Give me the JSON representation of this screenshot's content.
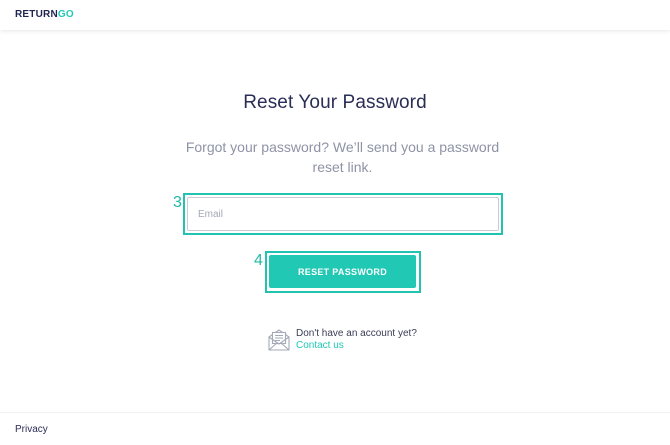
{
  "header": {
    "logo_part1": "RETURN",
    "logo_part2": "GO"
  },
  "main": {
    "title": "Reset Your Password",
    "subtitle": "Forgot your password? We’ll send you a password reset link.",
    "email": {
      "placeholder": "Email",
      "value": ""
    },
    "reset_button_label": "RESET PASSWORD",
    "annotations": {
      "email_marker": "3",
      "button_marker": "4"
    },
    "signup": {
      "prompt": "Don't have an account yet?",
      "link_label": "Contact us",
      "icon": "envelope-icon"
    }
  },
  "footer": {
    "privacy_label": "Privacy"
  },
  "colors": {
    "accent": "#21c9b5",
    "title": "#2a2d55",
    "subtitle": "#8e93a6"
  }
}
